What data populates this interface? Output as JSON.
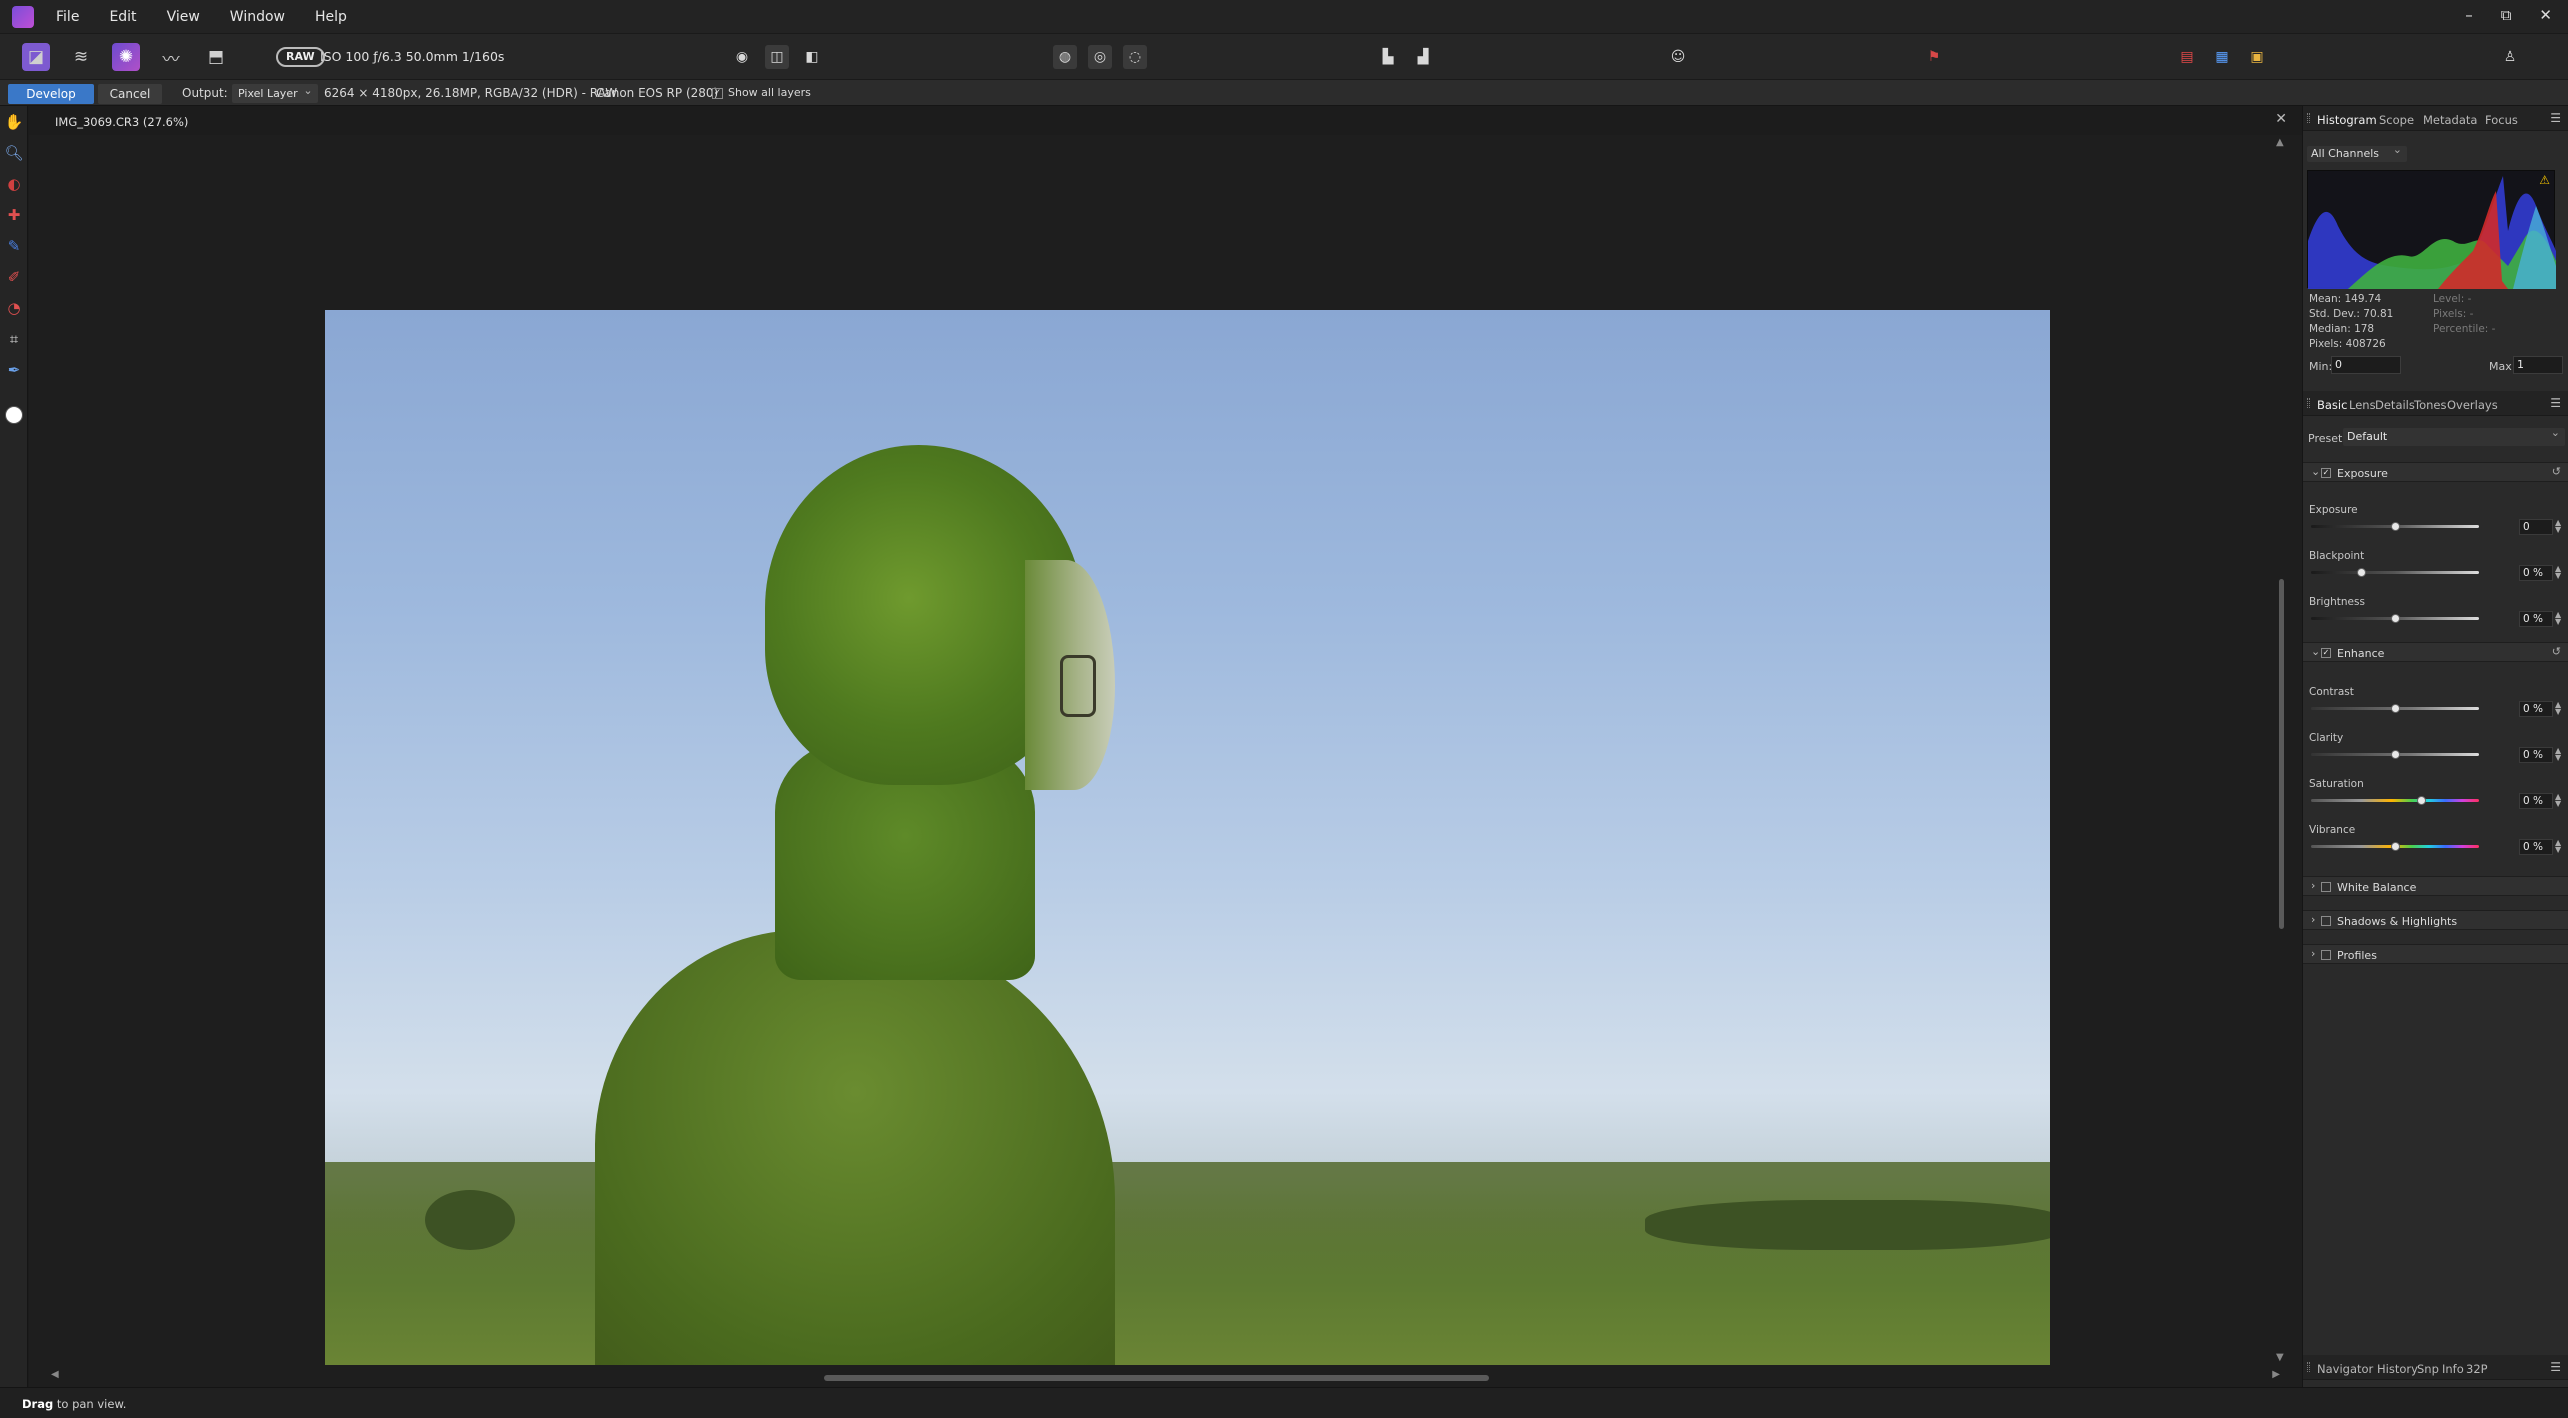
{
  "menu": {
    "items": [
      "File",
      "Edit",
      "View",
      "Window",
      "Help"
    ],
    "window_controls": [
      "–",
      "⧉",
      "✕"
    ]
  },
  "toolbar": {
    "raw_badge": "RAW",
    "camera_info": "ISO 100 ƒ/6.3 50.0mm 1/160s"
  },
  "context": {
    "develop": "Develop",
    "cancel": "Cancel",
    "output_label": "Output:",
    "output_value": "Pixel Layer",
    "image_info": "6264 × 4180px, 26.18MP, RGBA/32 (HDR) - RAW",
    "camera": "Canon EOS RP (280)",
    "show_all_layers": "Show all layers"
  },
  "document": {
    "title": "IMG_3069.CR3 (27.6%)"
  },
  "histogram_panel": {
    "tabs": [
      "Histogram",
      "Scope",
      "Metadata",
      "Focus"
    ],
    "channel": "All Channels",
    "stats": [
      "Mean: 149.74",
      "Std. Dev.: 70.81",
      "Median: 178",
      "Pixels: 408726"
    ],
    "stats_right": [
      "Level: -",
      "Pixels: -",
      "Percentile: -"
    ],
    "min_label": "Min:",
    "min_value": "0",
    "max_label": "Max:",
    "max_value": "1"
  },
  "develop_panel": {
    "tabs": [
      "Basic",
      "Lens",
      "Details",
      "Tones",
      "Overlays"
    ],
    "preset_label": "Preset:",
    "preset_value": "Default",
    "exposure_section": "Exposure",
    "enhance_section": "Enhance",
    "adjustments": {
      "exposure": {
        "label": "Exposure",
        "value": "0",
        "level": 0.5
      },
      "blackpoint": {
        "label": "Blackpoint",
        "value": "0 %",
        "level": 0.3
      },
      "brightness": {
        "label": "Brightness",
        "value": "0 %",
        "level": 0.5
      },
      "contrast": {
        "label": "Contrast",
        "value": "0 %",
        "level": 0.5
      },
      "clarity": {
        "label": "Clarity",
        "value": "0 %",
        "level": 0.5
      },
      "saturation": {
        "label": "Saturation",
        "value": "0 %",
        "level": 0.66
      },
      "vibrance": {
        "label": "Vibrance",
        "value": "0 %",
        "level": 0.5
      }
    },
    "collapsed_sections": [
      "White Balance",
      "Shadows & Highlights",
      "Profiles"
    ]
  },
  "bottom_panel": {
    "tabs": [
      "Navigator",
      "History",
      "Snp",
      "Info",
      "32P"
    ]
  },
  "status": {
    "action": "Drag",
    "hint": " to pan view."
  },
  "colors": {
    "accent": "#3a78c8",
    "persona_active": "#8a4fd0"
  }
}
